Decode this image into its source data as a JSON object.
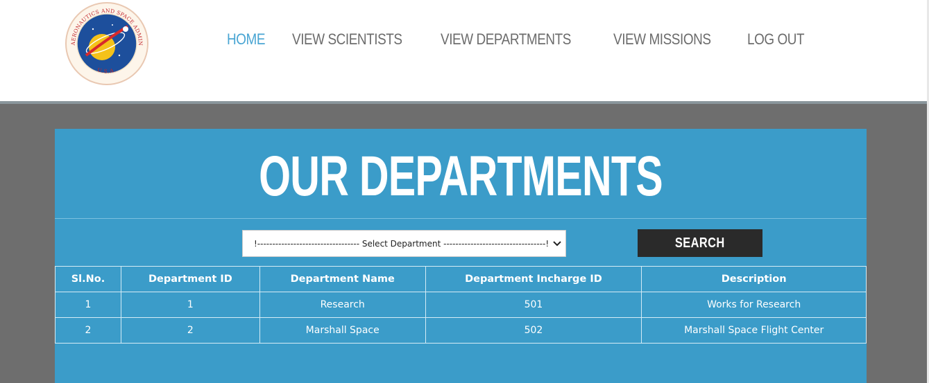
{
  "header": {
    "logo_text_top": "NATIONAL AERONAUTICS AND SPACE ADMINISTRATION",
    "logo_text_bottom": "U.S.A.",
    "nav": [
      {
        "label": "HOME",
        "active": true
      },
      {
        "label": "VIEW SCIENTISTS",
        "active": false
      },
      {
        "label": "VIEW DEPARTMENTS",
        "active": false
      },
      {
        "label": "VIEW MISSIONS",
        "active": false
      },
      {
        "label": "LOG OUT",
        "active": false
      }
    ]
  },
  "main": {
    "title": "OUR DEPARTMENTS",
    "department_select": {
      "selected": "!---------------------------------- Select Department ----------------------------------!"
    },
    "search_label": "SEARCH",
    "table": {
      "headers": [
        "Sl.No.",
        "Department ID",
        "Department Name",
        "Department Incharge ID",
        "Description"
      ],
      "rows": [
        [
          "1",
          "1",
          "Research",
          "501",
          "Works for Research"
        ],
        [
          "2",
          "2",
          "Marshall Space",
          "502",
          "Marshall Space Flight Center"
        ]
      ]
    }
  },
  "colors": {
    "nav_active": "#49a5d3",
    "nav_default": "#6c6c6c",
    "panel": "#3b9cc9",
    "page_bg": "#6e6e6e",
    "button": "#2a2a2a"
  }
}
